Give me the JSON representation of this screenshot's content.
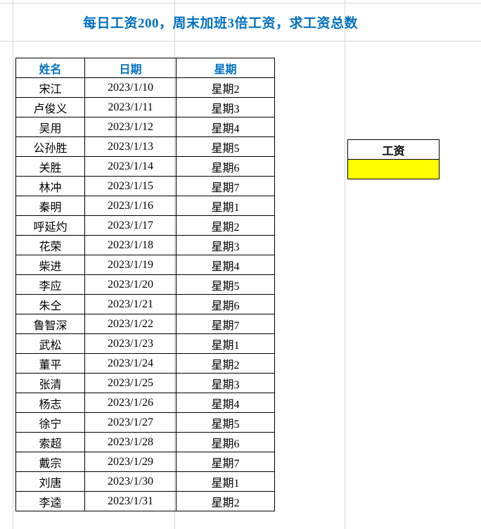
{
  "title": "每日工资200，周末加班3倍工资，求工资总数",
  "headers": {
    "name": "姓名",
    "date": "日期",
    "weekday": "星期"
  },
  "rows": [
    {
      "name": "宋江",
      "date": "2023/1/10",
      "weekday": "星期2"
    },
    {
      "name": "卢俊义",
      "date": "2023/1/11",
      "weekday": "星期3"
    },
    {
      "name": "吴用",
      "date": "2023/1/12",
      "weekday": "星期4"
    },
    {
      "name": "公孙胜",
      "date": "2023/1/13",
      "weekday": "星期5"
    },
    {
      "name": "关胜",
      "date": "2023/1/14",
      "weekday": "星期6"
    },
    {
      "name": "林冲",
      "date": "2023/1/15",
      "weekday": "星期7"
    },
    {
      "name": "秦明",
      "date": "2023/1/16",
      "weekday": "星期1"
    },
    {
      "name": "呼延灼",
      "date": "2023/1/17",
      "weekday": "星期2"
    },
    {
      "name": "花荣",
      "date": "2023/1/18",
      "weekday": "星期3"
    },
    {
      "name": "柴进",
      "date": "2023/1/19",
      "weekday": "星期4"
    },
    {
      "name": "李应",
      "date": "2023/1/20",
      "weekday": "星期5"
    },
    {
      "name": "朱仝",
      "date": "2023/1/21",
      "weekday": "星期6"
    },
    {
      "name": "鲁智深",
      "date": "2023/1/22",
      "weekday": "星期7"
    },
    {
      "name": "武松",
      "date": "2023/1/23",
      "weekday": "星期1"
    },
    {
      "name": "董平",
      "date": "2023/1/24",
      "weekday": "星期2"
    },
    {
      "name": "张清",
      "date": "2023/1/25",
      "weekday": "星期3"
    },
    {
      "name": "杨志",
      "date": "2023/1/26",
      "weekday": "星期4"
    },
    {
      "name": "徐宁",
      "date": "2023/1/27",
      "weekday": "星期5"
    },
    {
      "name": "索超",
      "date": "2023/1/28",
      "weekday": "星期6"
    },
    {
      "name": "戴宗",
      "date": "2023/1/29",
      "weekday": "星期7"
    },
    {
      "name": "刘唐",
      "date": "2023/1/30",
      "weekday": "星期1"
    },
    {
      "name": "李逵",
      "date": "2023/1/31",
      "weekday": "星期2"
    }
  ],
  "salary": {
    "header": "工资",
    "value": ""
  },
  "gridlines": {
    "vx": [
      18,
      248,
      490
    ],
    "hy": [
      4,
      58
    ]
  }
}
